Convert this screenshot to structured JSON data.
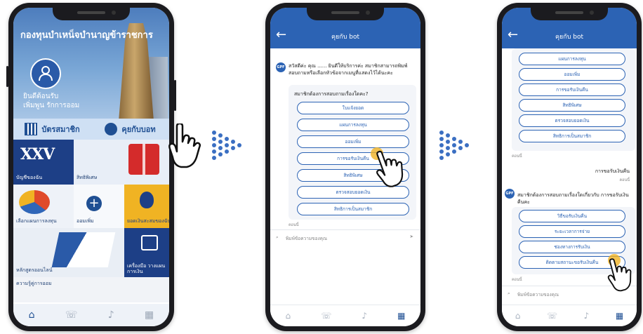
{
  "phone1": {
    "title": "กองทุนบำเหน็จบำนาญข้าราชการ",
    "welcome_line1": "ยินดีต้อนรับ",
    "welcome_line2": "เพิ่มพูน รักการออม",
    "card_label": "บัตรสมาชิก",
    "chat_label": "คุยกับบอท",
    "tiles": {
      "balance": "บัญชีของฉัน",
      "rights": "สิทธิพิเศษ",
      "plan": "เลือกแผนการลงทุน",
      "save_more": "ออมเพิ่ม",
      "transfer": "ยอดเงินสะสมของฉัน",
      "course": "หลักสูตรออนไลน์",
      "tools": "เครื่องมือ วางแผนการเงิน",
      "knowledge": "ความรู้คู่การออม",
      "logo_text": "XXV"
    }
  },
  "chat": {
    "title": "คุยกับ bot",
    "avatar_label": "GPF",
    "greeting": "สวัสดีค่ะ คุณ ...... ยินดีให้บริการค่ะ สมาชิกสามารถพิมพ์สอบถามหรือเลือกหัวข้อจากเมนูที่แสดงไว้ได้นะคะ",
    "question": "สมาชิกต้องการสอบถามเรื่องใดคะ?",
    "options": [
      "ใบแจ้งยอด",
      "แผนการลงทุน",
      "ออมเพิ่ม",
      "การขอรับเงินคืน",
      "สิทธิพิเศษ",
      "ตรวจสอบยอดเงิน",
      "สิทธิการเป็นสมาชิก"
    ],
    "time_label": "คอนนี้",
    "user_reply": "การขอรับเงินคืน",
    "followup": "สมาชิกต้องการสอบถามเรื่องใดเกี่ยวกับ การขอรับเงินคืนคะ",
    "followup_options": [
      "วิธีขอรับเงินคืน",
      "ระยะเวลาการจ่าย",
      "ช่องทางการรับเงิน",
      "ติดตามสถานะขอรับเงินคืน"
    ],
    "input_placeholder": "พิมพ์ข้อความของคุณ"
  },
  "colors": {
    "brand_blue": "#2c63b4",
    "nav_blue": "#1f4f93",
    "tile_gold": "#f0b323"
  },
  "icons": {
    "nav": [
      "home-icon",
      "chat-bot-icon",
      "bell-icon",
      "grid-icon"
    ]
  }
}
